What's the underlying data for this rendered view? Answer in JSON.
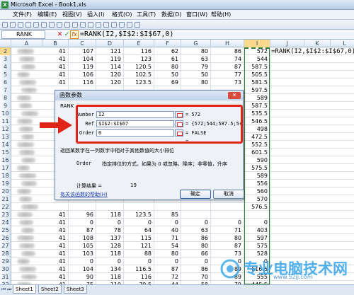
{
  "window": {
    "title": "Microsoft Excel - Book1.xls",
    "app_icon": "X"
  },
  "menu": [
    "文件(F)",
    "编辑(E)",
    "视图(V)",
    "插入(I)",
    "格式(O)",
    "工具(T)",
    "数据(D)",
    "窗口(W)",
    "帮助(H)"
  ],
  "toolbar": {
    "font_name": "宋体"
  },
  "formula_bar": {
    "name_box": "RANK",
    "cancel": "✕",
    "enter": "✓",
    "fx": "fx",
    "formula": "=RANK(I2,$I$2:$I$67,0)"
  },
  "grid": {
    "columns": [
      "A",
      "B",
      "C",
      "D",
      "E",
      "F",
      "G",
      "H",
      "I",
      "J",
      "K",
      "L"
    ],
    "selected_column": "I",
    "selected_row": "2",
    "j2_value": "=RANK(I2,$I$2:$I$67,0)",
    "rows": [
      {
        "n": "2",
        "b": "41",
        "c": "107",
        "d": "121",
        "e": "116",
        "f": "62",
        "g": "80",
        "h": "86",
        "i": "572"
      },
      {
        "n": "3",
        "b": "41",
        "c": "104",
        "d": "119",
        "e": "123",
        "f": "61",
        "g": "63",
        "h": "74",
        "i": "544"
      },
      {
        "n": "4",
        "b": "41",
        "c": "119",
        "d": "114",
        "e": "120.5",
        "f": "80",
        "g": "79",
        "h": "87",
        "i": "587.5"
      },
      {
        "n": "5",
        "b": "41",
        "c": "106",
        "d": "120",
        "e": "102.5",
        "f": "50",
        "g": "50",
        "h": "77",
        "i": "505.5"
      },
      {
        "n": "6",
        "b": "41",
        "c": "116",
        "d": "120",
        "e": "123.5",
        "f": "69",
        "g": "80",
        "h": "73",
        "i": "581.5"
      },
      {
        "n": "7",
        "b": "",
        "c": "",
        "d": "",
        "e": "",
        "f": "",
        "g": "",
        "h": "",
        "i": "597.5"
      },
      {
        "n": "8",
        "b": "",
        "c": "",
        "d": "",
        "e": "",
        "f": "",
        "g": "",
        "h": "",
        "i": "589"
      },
      {
        "n": "9",
        "b": "",
        "c": "",
        "d": "",
        "e": "",
        "f": "",
        "g": "",
        "h": "",
        "i": "587.5"
      },
      {
        "n": "10",
        "b": "",
        "c": "",
        "d": "",
        "e": "",
        "f": "",
        "g": "",
        "h": "",
        "i": "535.5"
      },
      {
        "n": "11",
        "b": "",
        "c": "",
        "d": "",
        "e": "",
        "f": "",
        "g": "",
        "h": "",
        "i": "546.5"
      },
      {
        "n": "12",
        "b": "",
        "c": "",
        "d": "",
        "e": "",
        "f": "",
        "g": "",
        "h": "",
        "i": "498"
      },
      {
        "n": "13",
        "b": "",
        "c": "",
        "d": "",
        "e": "",
        "f": "",
        "g": "",
        "h": "",
        "i": "472.5"
      },
      {
        "n": "14",
        "b": "",
        "c": "",
        "d": "",
        "e": "",
        "f": "",
        "g": "",
        "h": "",
        "i": "552.5"
      },
      {
        "n": "15",
        "b": "",
        "c": "",
        "d": "",
        "e": "",
        "f": "",
        "g": "",
        "h": "",
        "i": "601.5"
      },
      {
        "n": "16",
        "b": "",
        "c": "",
        "d": "",
        "e": "",
        "f": "",
        "g": "",
        "h": "",
        "i": "590"
      },
      {
        "n": "17",
        "b": "",
        "c": "",
        "d": "",
        "e": "",
        "f": "",
        "g": "",
        "h": "",
        "i": "575.5"
      },
      {
        "n": "18",
        "b": "",
        "c": "",
        "d": "",
        "e": "",
        "f": "",
        "g": "",
        "h": "",
        "i": "589"
      },
      {
        "n": "19",
        "b": "",
        "c": "",
        "d": "",
        "e": "",
        "f": "",
        "g": "",
        "h": "",
        "i": "556"
      },
      {
        "n": "20",
        "b": "",
        "c": "",
        "d": "",
        "e": "",
        "f": "",
        "g": "",
        "h": "",
        "i": "560"
      },
      {
        "n": "21",
        "b": "",
        "c": "",
        "d": "",
        "e": "",
        "f": "",
        "g": "",
        "h": "",
        "i": "570"
      },
      {
        "n": "22",
        "b": "",
        "c": "",
        "d": "",
        "e": "",
        "f": "",
        "g": "",
        "h": "",
        "i": "576.5"
      },
      {
        "n": "23",
        "b": "41",
        "c": "96",
        "d": "118",
        "e": "123.5",
        "f": "85",
        "g": "",
        "h": "",
        "i": ""
      },
      {
        "n": "24",
        "b": "41",
        "c": "0",
        "d": "0",
        "e": "0",
        "f": "0",
        "g": "0",
        "h": "0",
        "i": "0"
      },
      {
        "n": "25",
        "b": "41",
        "c": "87",
        "d": "78",
        "e": "64",
        "f": "40",
        "g": "63",
        "h": "71",
        "i": "403"
      },
      {
        "n": "26",
        "b": "41",
        "c": "108",
        "d": "137",
        "e": "115",
        "f": "71",
        "g": "86",
        "h": "80",
        "i": "597"
      },
      {
        "n": "27",
        "b": "41",
        "c": "105",
        "d": "128",
        "e": "121",
        "f": "54",
        "g": "80",
        "h": "87",
        "i": "575"
      },
      {
        "n": "28",
        "b": "41",
        "c": "103",
        "d": "118",
        "e": "88",
        "f": "80",
        "g": "66",
        "h": "73",
        "i": "528"
      },
      {
        "n": "29",
        "b": "41",
        "c": "0",
        "d": "0",
        "e": "0",
        "f": "0",
        "g": "0",
        "h": "0",
        "i": "0"
      },
      {
        "n": "30",
        "b": "41",
        "c": "104",
        "d": "134",
        "e": "116.5",
        "f": "87",
        "g": "86",
        "h": "89",
        "i": "616.5"
      },
      {
        "n": "31",
        "b": "41",
        "c": "90",
        "d": "118",
        "e": "116",
        "f": "72",
        "g": "70",
        "h": "89",
        "i": "555"
      },
      {
        "n": "32",
        "b": "41",
        "c": "75",
        "d": "110",
        "e": "79.5",
        "f": "44",
        "g": "58",
        "h": "79",
        "i": "445.5"
      }
    ]
  },
  "sheets": [
    "Sheet1",
    "Sheet2",
    "Sheet3"
  ],
  "active_sheet": "Sheet1",
  "dialog": {
    "title": "函数参数",
    "close": "✕",
    "function_name": "RANK",
    "args": [
      {
        "label": "Number",
        "value": "I2",
        "result": "= 572"
      },
      {
        "label": "Ref",
        "value": "$I$2:$I$67",
        "result": "= {572;544;587.5;5("
      },
      {
        "label": "Order",
        "value": "0",
        "result": "= FALSE"
      }
    ],
    "after_args_result": "=",
    "description": "返回某数字在一列数字中相对于其他数值的大小排位",
    "order_label": "Order",
    "order_help": "指定排位的方式。如果为 0 或忽略，降序；非零值，升序",
    "result_label": "计算结果 =",
    "result_value": "19",
    "help_link": "有关该函数的帮助(H)",
    "ok": "确定",
    "cancel": "取消"
  },
  "watermark": {
    "text": "专业电脑技术网",
    "url": "www.52jj.com"
  },
  "colors": {
    "highlight": "#e02418",
    "selection": "#2f7c2f"
  }
}
